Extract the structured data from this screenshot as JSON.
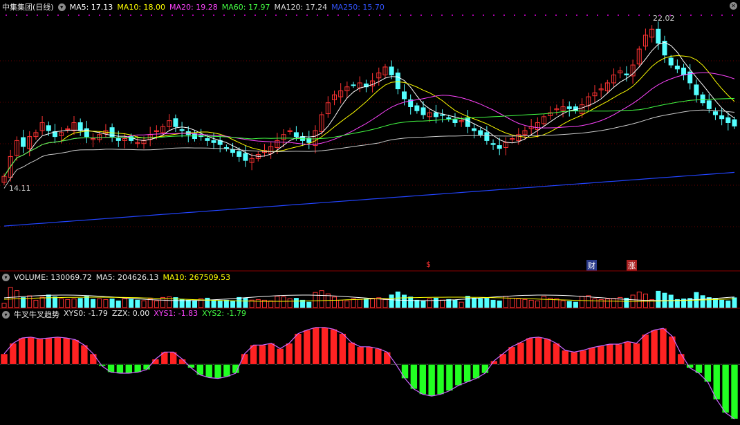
{
  "main_panel": {
    "title": "中集集团(日线)",
    "ma_labels": [
      {
        "text": "MA5: 17.13",
        "color": "#ffffff"
      },
      {
        "text": "MA10: 18.00",
        "color": "#ffff00"
      },
      {
        "text": "MA20: 19.28",
        "color": "#ff44ff"
      },
      {
        "text": "MA60: 17.97",
        "color": "#44ff44"
      },
      {
        "text": "MA120: 17.24",
        "color": "#dddddd"
      },
      {
        "text": "MA250: 15.70",
        "color": "#3355ff"
      }
    ],
    "high_label": "22.02",
    "low_label": "14.11",
    "events": [
      {
        "text": "$",
        "color": "#ff3333",
        "bg": "transparent"
      },
      {
        "text": "财",
        "color": "#ffffff",
        "bg": "#2a3a8a"
      },
      {
        "text": "涨",
        "color": "#ffffff",
        "bg": "#aa2222"
      }
    ]
  },
  "volume_panel": {
    "labels": [
      {
        "text": "VOLUME: 130069.72",
        "color": "#e8e8e8"
      },
      {
        "text": "MA5: 204626.13",
        "color": "#e8e8e8"
      },
      {
        "text": "MA10: 267509.53",
        "color": "#ffff00"
      }
    ]
  },
  "indicator_panel": {
    "labels": [
      {
        "text": "牛叉牛叉趋势",
        "color": "#e8e8e8"
      },
      {
        "text": "XYS0: -1.79",
        "color": "#e8e8e8"
      },
      {
        "text": "ZZX: 0.00",
        "color": "#e8e8e8"
      },
      {
        "text": "XYS1: -1.83",
        "color": "#ff44ff"
      },
      {
        "text": "XYS2: -1.79",
        "color": "#44ff44"
      }
    ]
  },
  "chart_data": {
    "type": "candlestick",
    "up_color": "#ff3333",
    "down_color": "#54ffff",
    "price_range": [
      12.0,
      22.6
    ],
    "close": [
      14.6,
      15.6,
      16.4,
      16.1,
      16.6,
      16.8,
      17.3,
      16.9,
      16.6,
      16.8,
      17.0,
      17.3,
      16.9,
      16.6,
      16.5,
      16.7,
      16.9,
      16.6,
      16.4,
      16.5,
      16.4,
      16.3,
      16.4,
      16.7,
      16.9,
      17.1,
      17.4,
      17.1,
      16.9,
      16.7,
      16.5,
      16.6,
      16.4,
      16.3,
      16.2,
      16.0,
      15.8,
      15.6,
      15.4,
      15.5,
      15.7,
      15.9,
      16.1,
      16.4,
      16.7,
      16.9,
      16.6,
      16.4,
      16.3,
      16.9,
      17.7,
      18.3,
      18.7,
      18.9,
      19.1,
      19.2,
      19.3,
      19.1,
      19.4,
      19.8,
      20.1,
      19.7,
      19.0,
      18.5,
      18.1,
      17.9,
      17.7,
      17.8,
      17.6,
      17.7,
      17.5,
      17.3,
      17.4,
      17.1,
      16.9,
      16.7,
      16.4,
      16.2,
      16.0,
      16.3,
      16.5,
      16.7,
      16.9,
      17.1,
      17.3,
      17.6,
      17.8,
      18.0,
      18.1,
      18.0,
      17.9,
      18.2,
      18.6,
      18.8,
      19.0,
      19.3,
      19.7,
      19.9,
      19.7,
      20.2,
      21.0,
      21.7,
      22.0,
      21.3,
      20.7,
      20.2,
      20.0,
      19.7,
      19.3,
      18.7,
      18.3,
      18.0,
      17.7,
      17.5,
      17.3,
      17.13
    ],
    "ma5_last": 17.13,
    "ma10_last": 18.0,
    "ma20_last": 19.28,
    "ma60_last": 17.97,
    "ma120_last": 17.24,
    "ma250_last": 15.7,
    "ma250_range": [
      13.0,
      15.7
    ],
    "volume_ma5_last": 204626.13,
    "volume_ma10_last": 267509.53,
    "volume_last": 130069.72,
    "xys0_last": -1.79,
    "xys1_last": -1.83,
    "xys2_last": -1.79,
    "zzx": 0.0,
    "oscillator": [
      1.2,
      2.4,
      3.0,
      3.1,
      2.9,
      3.0,
      3.1,
      3.0,
      2.8,
      2.2,
      1.2,
      -0.2,
      -0.9,
      -1.0,
      -1.0,
      -0.9,
      -0.6,
      0.6,
      1.4,
      1.4,
      0.6,
      -0.4,
      -1.2,
      -1.5,
      -1.6,
      -1.4,
      -1.0,
      1.2,
      2.2,
      2.2,
      2.4,
      1.8,
      2.4,
      3.5,
      3.9,
      4.2,
      4.2,
      4.0,
      3.5,
      2.5,
      2.0,
      2.0,
      1.8,
      1.4,
      0.0,
      -1.6,
      -2.8,
      -3.4,
      -3.6,
      -3.4,
      -3.0,
      -2.4,
      -2.0,
      -1.6,
      -1.0,
      0.4,
      1.2,
      2.0,
      2.5,
      3.0,
      3.1,
      2.9,
      2.4,
      1.6,
      1.4,
      1.6,
      1.9,
      2.1,
      2.3,
      2.3,
      2.6,
      2.4,
      3.4,
      3.9,
      4.1,
      3.2,
      1.2,
      -0.4,
      -1.0,
      -2.0,
      -4.0,
      -5.5,
      -6.2
    ],
    "oscillator_range": [
      -6.5,
      4.5
    ]
  }
}
